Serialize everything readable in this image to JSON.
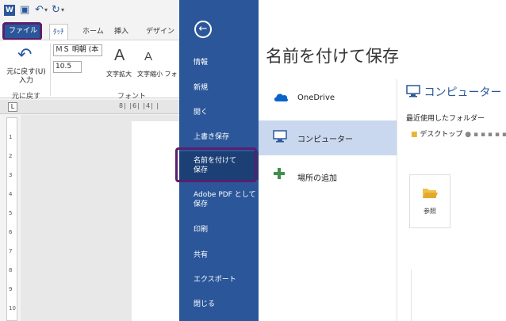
{
  "quick_access": {
    "app_icon": "W"
  },
  "ribbon_tabs": {
    "file": "ファイル",
    "draw": "ﾀｯﾁ",
    "home": "ホーム",
    "insert": "挿入",
    "design": "デザイン"
  },
  "ribbon": {
    "undo_label": "元に戻す(U)\n入力",
    "undo_group": "元に戻す",
    "font_name": "ＭＳ 明朝 (本",
    "font_size": "10.5",
    "grow_font": "文字拡大",
    "shrink_font": "文字縮小 フォ",
    "font_group": "フォント"
  },
  "ruler": {
    "top_marks": "8| |6| |4| |",
    "corner": "L",
    "left_marks": [
      "1",
      "2",
      "3",
      "4",
      "5",
      "6",
      "7",
      "8",
      "9",
      "10"
    ]
  },
  "backstage": {
    "nav": {
      "info": "情報",
      "new": "新規",
      "open": "開く",
      "save": "上書き保存",
      "save_as": "名前を付けて\n保存",
      "adobe_pdf": "Adobe PDF として\n保存",
      "print": "印刷",
      "share": "共有",
      "export": "エクスポート",
      "close": "閉じる"
    },
    "title": "名前を付けて保存",
    "locations": {
      "onedrive": "OneDrive",
      "computer": "コンピューター",
      "add_place": "場所の追加"
    },
    "computer_pane": {
      "heading": "コンピューター",
      "recent_label": "最近使用したフォルダー",
      "recent_folder": "デスクトップ",
      "browse": "参照"
    }
  },
  "colors": {
    "word_blue": "#2b579a",
    "highlight_purple": "#5b1e6e",
    "selected_location": "#c9d8ee"
  }
}
